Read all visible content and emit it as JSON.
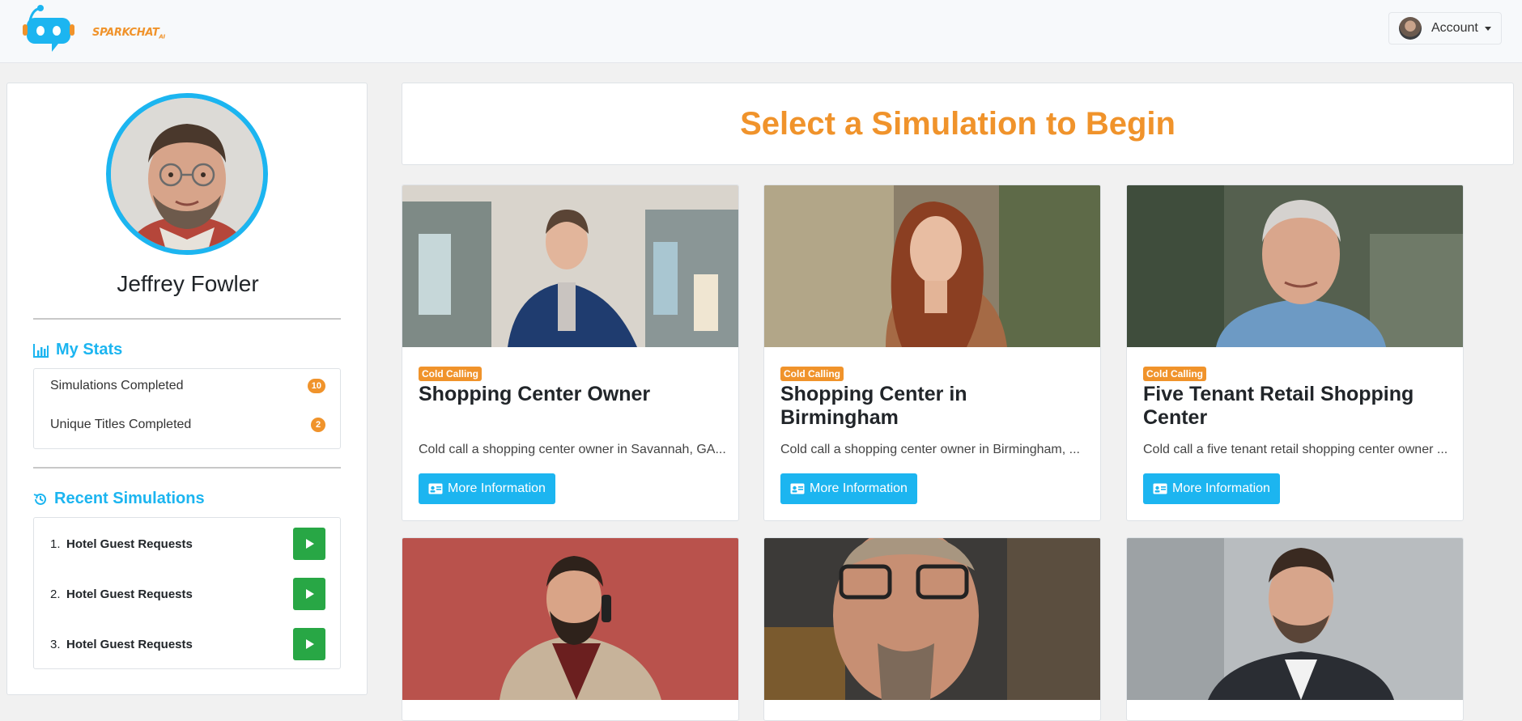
{
  "navbar": {
    "logo_text": "SPARKCHAT",
    "logo_suffix": "AI",
    "account_label": "Account"
  },
  "sidebar": {
    "profile_name": "Jeffrey Fowler",
    "stats_title": "My Stats",
    "stats": [
      {
        "label": "Simulations Completed",
        "value": "10"
      },
      {
        "label": "Unique Titles Completed",
        "value": "2"
      }
    ],
    "recent_title": "Recent Simulations",
    "recent": [
      {
        "num": "1.",
        "title": "Hotel Guest Requests"
      },
      {
        "num": "2.",
        "title": "Hotel Guest Requests"
      },
      {
        "num": "3.",
        "title": "Hotel Guest Requests"
      }
    ]
  },
  "main": {
    "header_title": "Select a Simulation to Begin",
    "button_label": "More Information",
    "cards": [
      {
        "tag": "Cold Calling",
        "title": "Shopping Center Owner",
        "desc": "Cold call a shopping center owner in Savannah, GA...."
      },
      {
        "tag": "Cold Calling",
        "title": "Shopping Center in Birmingham",
        "desc": "Cold call a shopping center owner in Birmingham, ..."
      },
      {
        "tag": "Cold Calling",
        "title": "Five Tenant Retail Shopping Center",
        "desc": "Cold call a five tenant retail shopping center owner ..."
      }
    ]
  },
  "colors": {
    "accent_blue": "#1cb5f0",
    "accent_orange": "#f0932b",
    "play_green": "#28a745"
  }
}
